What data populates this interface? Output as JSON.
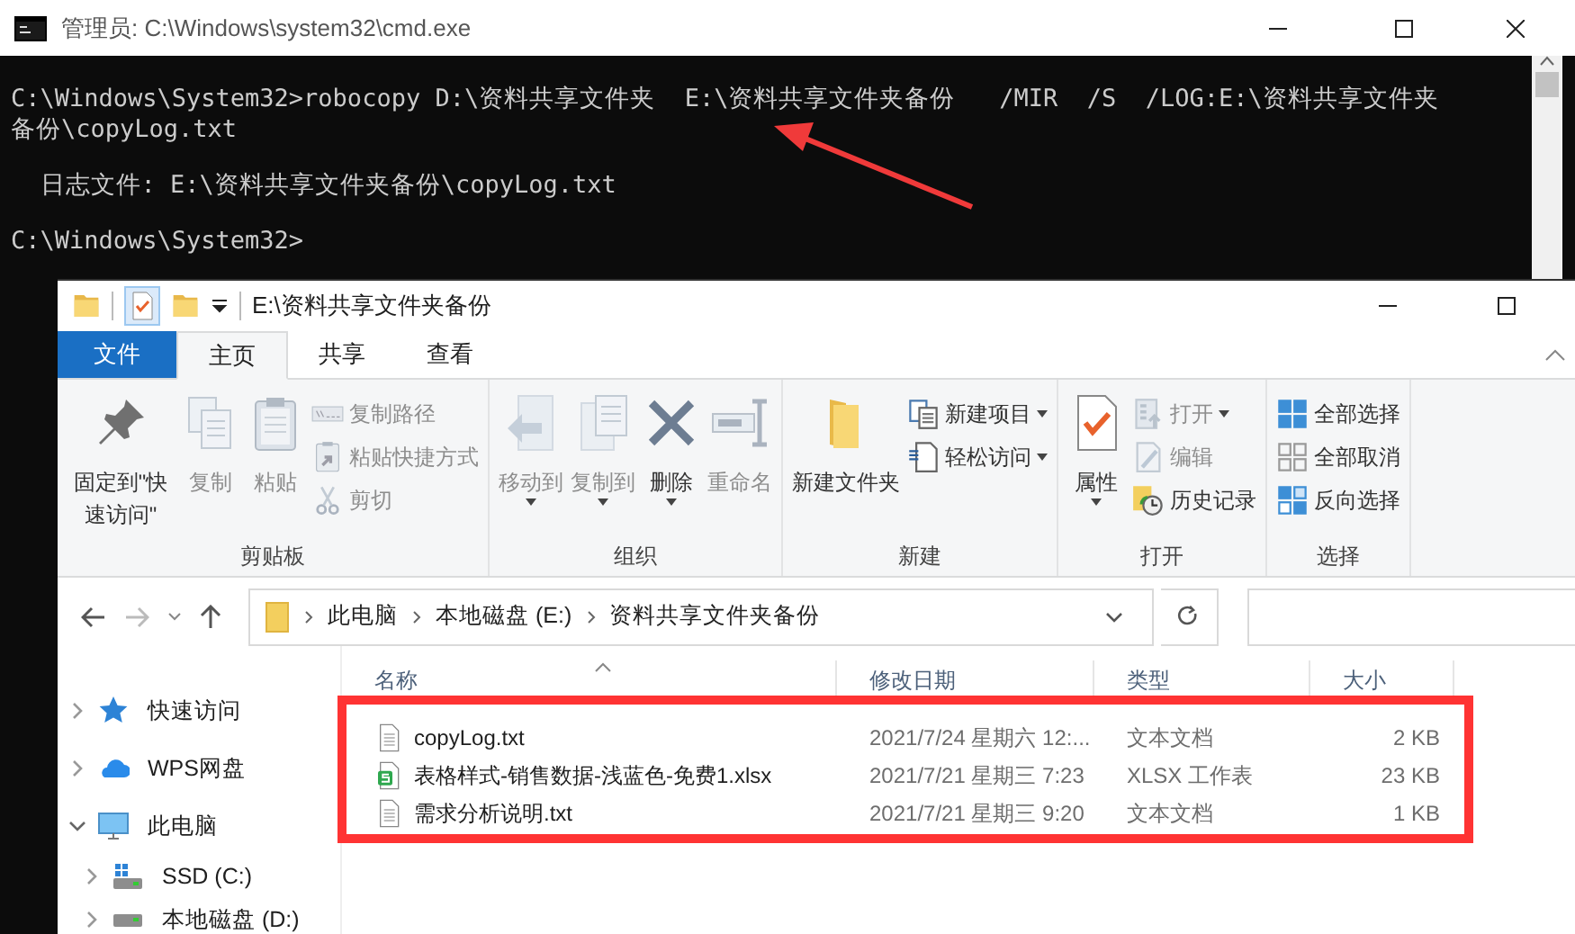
{
  "cmd_window": {
    "title": "管理员: C:\\Windows\\system32\\cmd.exe",
    "blocks": [
      [
        "C:\\Windows\\System32>robocopy D:\\资料共享文件夹  E:\\资料共享文件夹备份   /MIR  /S  /LOG:E:\\资料共享文件夹",
        "备份\\copyLog.txt"
      ],
      [
        "  日志文件: E:\\资料共享文件夹备份\\copyLog.txt"
      ],
      [
        "C:\\Windows\\System32>"
      ]
    ]
  },
  "explorer": {
    "title": "E:\\资料共享文件夹备份",
    "tabs": [
      {
        "label": "文件",
        "kind": "file",
        "selected": false
      },
      {
        "label": "主页",
        "kind": "tab",
        "selected": true
      },
      {
        "label": "共享",
        "kind": "tab",
        "selected": false
      },
      {
        "label": "查看",
        "kind": "tab",
        "selected": false
      }
    ],
    "ribbon": [
      {
        "label": "剪贴板",
        "items": [
          {
            "label": "固定到\"快速访问\"",
            "kind": "large",
            "disabled": false,
            "dropdown": false
          },
          {
            "label": "复制",
            "kind": "large",
            "disabled": true,
            "dropdown": false
          },
          {
            "label": "粘贴",
            "kind": "large",
            "disabled": true,
            "dropdown": false
          },
          {
            "label": "复制路径",
            "kind": "small",
            "disabled": true,
            "dropdown": false
          },
          {
            "label": "粘贴快捷方式",
            "kind": "small",
            "disabled": true,
            "dropdown": false
          },
          {
            "label": "剪切",
            "kind": "small",
            "disabled": true,
            "dropdown": false
          }
        ]
      },
      {
        "label": "组织",
        "items": [
          {
            "label": "移动到",
            "kind": "large",
            "disabled": true,
            "dropdown": true
          },
          {
            "label": "复制到",
            "kind": "large",
            "disabled": true,
            "dropdown": true
          },
          {
            "label": "删除",
            "kind": "large",
            "disabled": false,
            "dropdown": true
          },
          {
            "label": "重命名",
            "kind": "large",
            "disabled": true,
            "dropdown": false
          }
        ]
      },
      {
        "label": "新建",
        "items": [
          {
            "label": "新建文件夹",
            "kind": "large",
            "disabled": false,
            "dropdown": false
          },
          {
            "label": "新建项目",
            "kind": "small",
            "disabled": false,
            "dropdown": true
          },
          {
            "label": "轻松访问",
            "kind": "small",
            "disabled": false,
            "dropdown": true
          }
        ]
      },
      {
        "label": "打开",
        "items": [
          {
            "label": "属性",
            "kind": "large",
            "disabled": false,
            "dropdown": true
          },
          {
            "label": "打开",
            "kind": "small",
            "disabled": true,
            "dropdown": true
          },
          {
            "label": "编辑",
            "kind": "small",
            "disabled": true,
            "dropdown": false
          },
          {
            "label": "历史记录",
            "kind": "small",
            "disabled": false,
            "dropdown": false
          }
        ]
      },
      {
        "label": "选择",
        "items": [
          {
            "label": "全部选择",
            "kind": "small",
            "disabled": false,
            "dropdown": false
          },
          {
            "label": "全部取消",
            "kind": "small",
            "disabled": false,
            "dropdown": false
          },
          {
            "label": "反向选择",
            "kind": "small",
            "disabled": false,
            "dropdown": false
          }
        ]
      }
    ],
    "breadcrumb": [
      "此电脑",
      "本地磁盘 (E:)",
      "资料共享文件夹备份"
    ],
    "sidebar": {
      "items": [
        {
          "label": "快速访问",
          "kind": "quick",
          "expanded": false
        },
        {
          "label": "WPS网盘",
          "kind": "cloud",
          "expanded": false
        },
        {
          "label": "此电脑",
          "kind": "pc",
          "expanded": true,
          "children": [
            {
              "label": "SSD (C:)",
              "kind": "system_drive",
              "expanded": false
            },
            {
              "label": "本地磁盘 (D:)",
              "kind": "drive",
              "expanded": false
            }
          ]
        }
      ]
    },
    "table": {
      "columns": [
        "名称",
        "修改日期",
        "类型",
        "大小"
      ],
      "rows": [
        {
          "kind": "txt",
          "selected": false,
          "cells": [
            "copyLog.txt",
            "2021/7/24 星期六 12:...",
            "文本文档",
            "2 KB"
          ]
        },
        {
          "kind": "xlsx",
          "selected": false,
          "cells": [
            "表格样式-销售数据-浅蓝色-免费1.xlsx",
            "2021/7/21 星期三 7:23",
            "XLSX 工作表",
            "23 KB"
          ]
        },
        {
          "kind": "txt",
          "selected": false,
          "cells": [
            "需求分析说明.txt",
            "2021/7/21 星期三 9:20",
            "文本文档",
            "1 KB"
          ]
        }
      ]
    }
  }
}
